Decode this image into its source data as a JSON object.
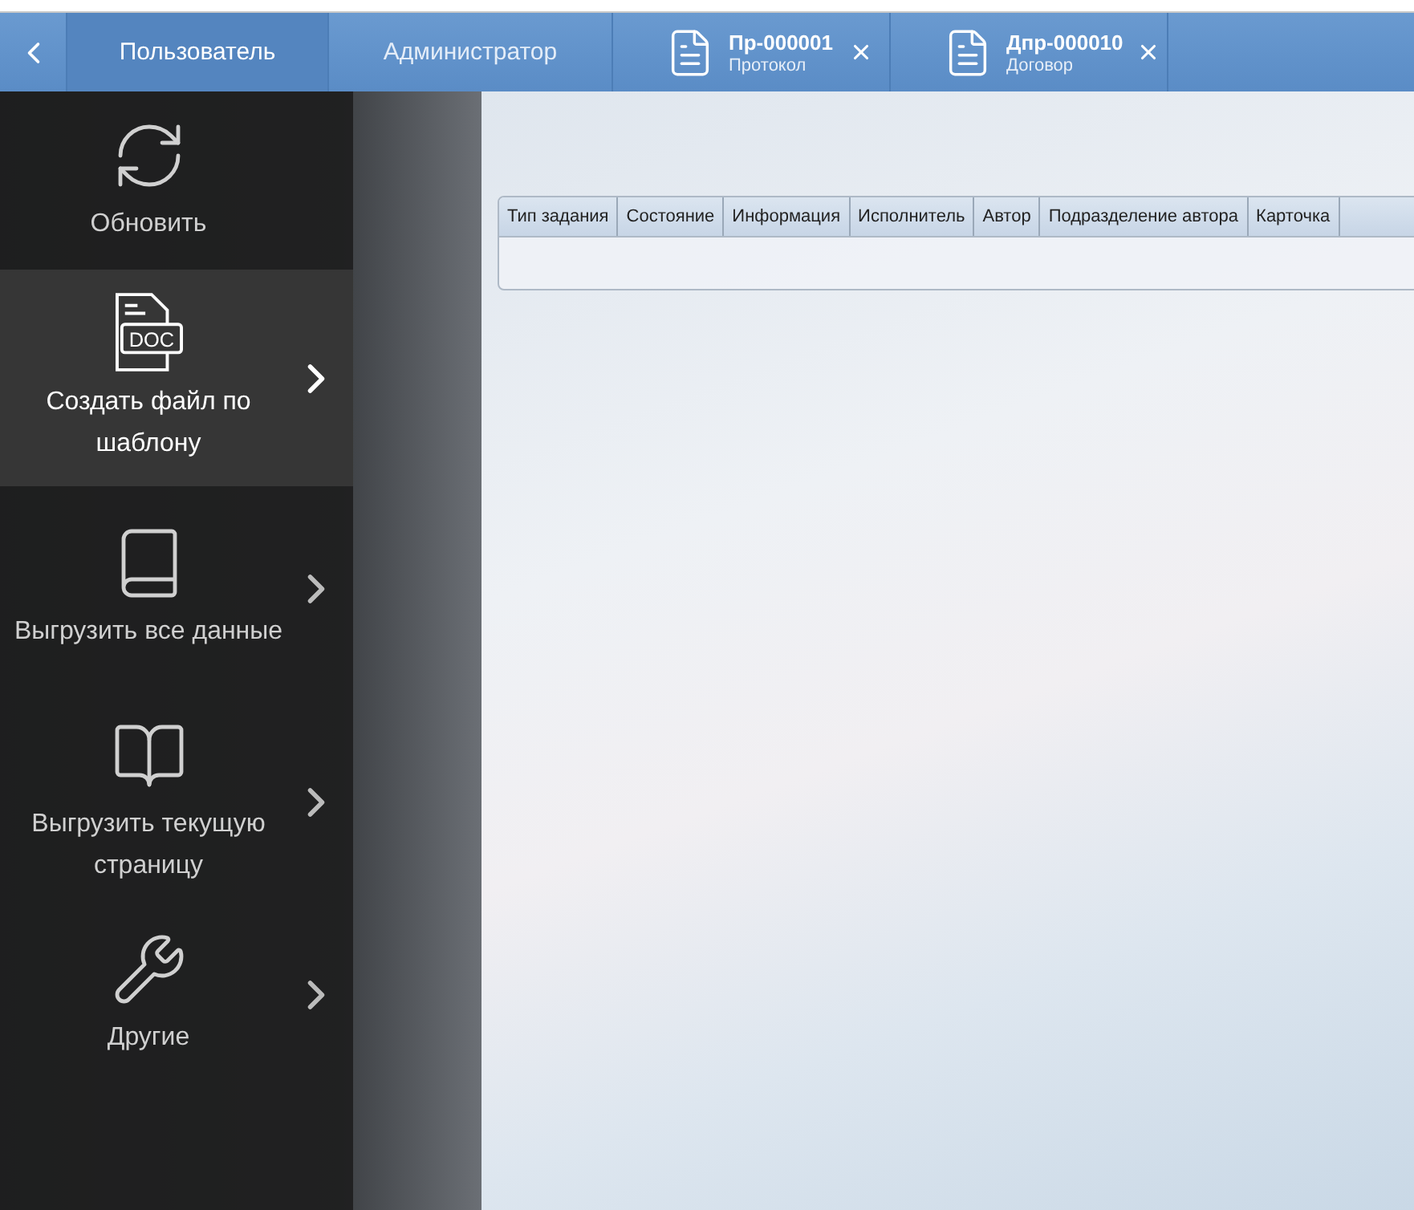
{
  "top_bar": {
    "tabs": [
      {
        "label": "Пользователь",
        "selected": true
      },
      {
        "label": "Администратор",
        "selected": false
      }
    ],
    "documents": [
      {
        "number": "Пр-000001",
        "type": "Протокол"
      },
      {
        "number": "Дпр-000010",
        "type": "Договор"
      }
    ]
  },
  "action_menu": [
    {
      "label": "Обновить",
      "submenu": false,
      "selected": false
    },
    {
      "label": "Создать файл по шаблону",
      "icon_text": "DOC",
      "submenu": true,
      "selected": true
    },
    {
      "label": "Выгрузить все данные",
      "submenu": true,
      "selected": false
    },
    {
      "label": "Выгрузить текущую страницу",
      "submenu": true,
      "selected": false
    },
    {
      "label": "Другие",
      "submenu": true,
      "selected": false
    }
  ],
  "task_table": {
    "columns": [
      "Тип задания",
      "Состояние",
      "Информация",
      "Исполнитель",
      "Автор",
      "Подразделение автора",
      "Карточка"
    ]
  }
}
